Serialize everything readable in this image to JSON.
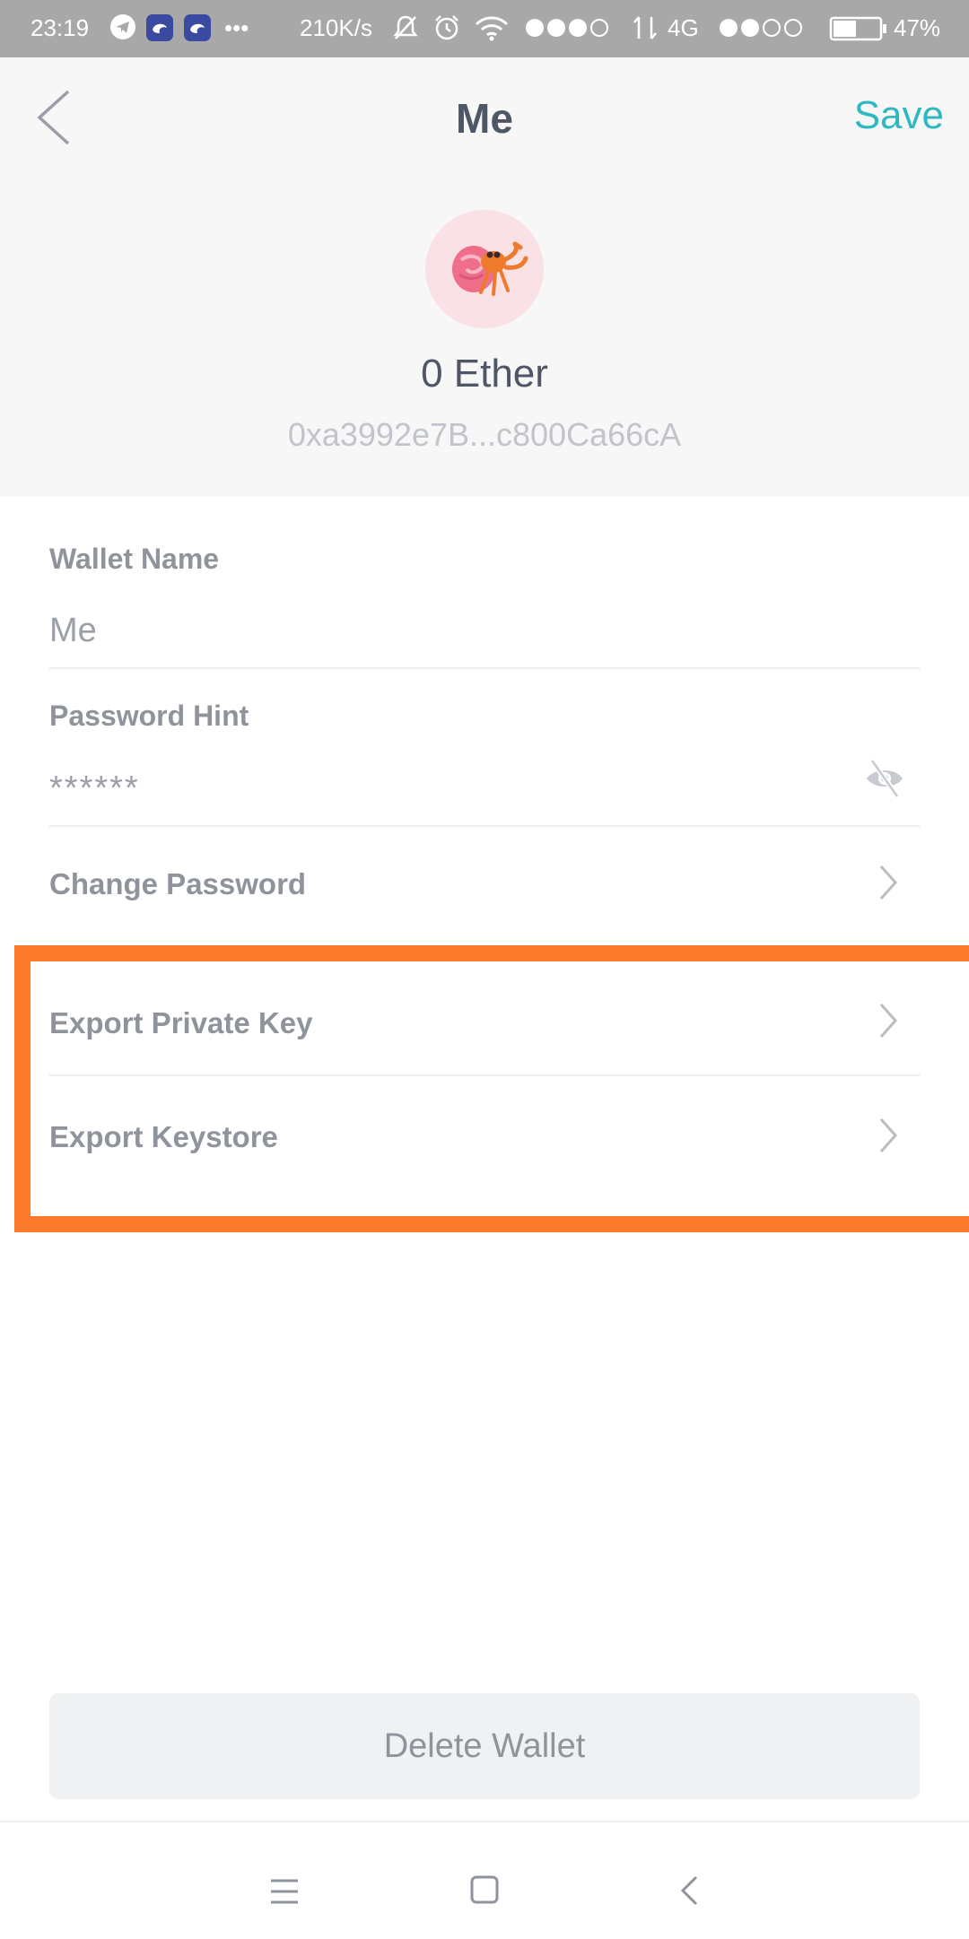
{
  "status_bar": {
    "time": "23:19",
    "dots": "•••",
    "speed": "210K/s",
    "network": "4G",
    "battery": "47%"
  },
  "header": {
    "title": "Me",
    "save_label": "Save",
    "balance": "0 Ether",
    "address": "0xa3992e7B...c800Ca66cA"
  },
  "form": {
    "wallet_name_label": "Wallet Name",
    "wallet_name_value": "Me",
    "password_hint_label": "Password Hint",
    "password_hint_value": "******",
    "change_password_label": "Change Password",
    "export_private_key_label": "Export Private Key",
    "export_keystore_label": "Export Keystore"
  },
  "delete_label": "Delete Wallet",
  "colors": {
    "accent": "#2fb8c1",
    "highlight": "#fd7a2d",
    "text_dark": "#4f5665",
    "text_muted": "#8e939c"
  },
  "icons": [
    "back-arrow-icon",
    "hermit-crab-avatar-icon",
    "eye-off-icon",
    "chevron-right-icon",
    "menu-icon",
    "home-square-icon",
    "back-nav-icon"
  ]
}
